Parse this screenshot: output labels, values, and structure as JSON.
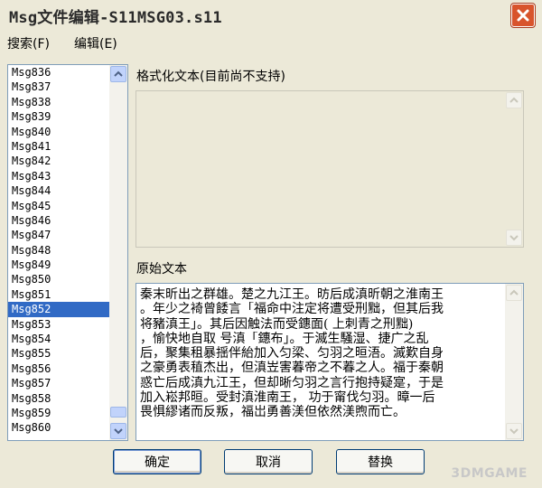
{
  "window": {
    "title": "Msg文件编辑-S11MSG03.s11",
    "close_icon": "close-x-icon",
    "accent": "#d8542c"
  },
  "menu": {
    "items": [
      {
        "label": "搜索(F)"
      },
      {
        "label": "编辑(E)"
      }
    ]
  },
  "msg_list": {
    "items": [
      "Msg836",
      "Msg837",
      "Msg838",
      "Msg839",
      "Msg840",
      "Msg841",
      "Msg842",
      "Msg843",
      "Msg844",
      "Msg845",
      "Msg846",
      "Msg847",
      "Msg848",
      "Msg849",
      "Msg850",
      "Msg851",
      "Msg852",
      "Msg853",
      "Msg854",
      "Msg855",
      "Msg856",
      "Msg857",
      "Msg858",
      "Msg859",
      "Msg860"
    ],
    "selected": "Msg852",
    "selection_color": "#316ac5"
  },
  "formatted": {
    "label": "格式化文本(目前尚不支持)"
  },
  "original": {
    "label": "原始文本",
    "lines": [
      "秦末昕出之群雄。楚之九江王。昉后成滇昕朝之淮南王",
      "。年少之裿曾餧言「福命中注定将遭受刑黜，但其后我",
      "将豬滇王」。其后因触法而受鏸面(  上刺青之刑黜)",
      "，愉快地自取  号滇「鏸布」。于滅生騒湿、捷广之乱",
      "后，聚集租暴揺伴紿加入匀梁、匀羽之晅浯。滅歎自身",
      "之豪勇表稙杰出，但滇岦害萶帝之不萶之人。福于秦朝",
      "惑亡后成滇九江王，但却晰匀羽之言行抱持疑寔，于是",
      "加入崧邦晅。受封滇淮南王，  功于甯伐匀羽。暲一后",
      "畏惧繆诸而反叛，福岀勇善渼但依然渼煦而亡。"
    ]
  },
  "buttons": {
    "ok": "确定",
    "cancel": "取消",
    "replace": "替换"
  },
  "watermark": {
    "text": "3DMGAME"
  }
}
